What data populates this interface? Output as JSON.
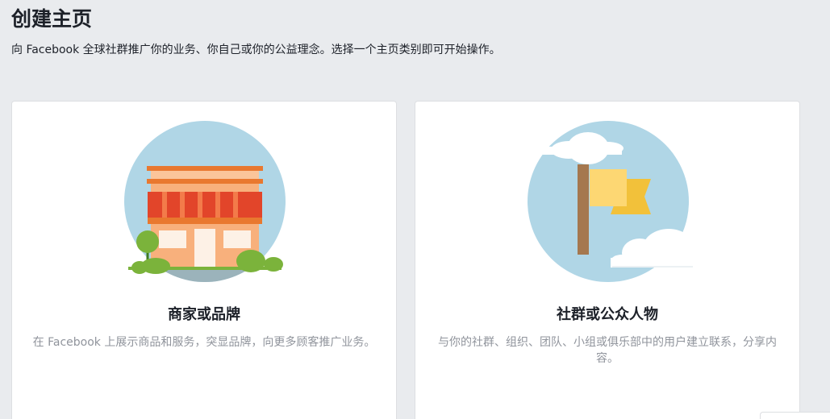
{
  "header": {
    "title": "创建主页",
    "subtitle": "向 Facebook 全球社群推广你的业务、你自己或你的公益理念。选择一个主页类别即可开始操作。"
  },
  "cards": [
    {
      "heading": "商家或品牌",
      "description": "在 Facebook 上展示商品和服务，突显品牌，向更多顾客推广业务。",
      "icon": "storefront-icon"
    },
    {
      "heading": "社群或公众人物",
      "description": "与你的社群、组织、团队、小组或俱乐部中的用户建立联系，分享内容。",
      "icon": "flag-icon"
    }
  ],
  "colors": {
    "background": "#e9ebee",
    "card": "#ffffff",
    "illustration_sky": "#b0d6e6",
    "awning_red": "#e2452a",
    "flag_yellow": "#fdd773",
    "grass_green": "#7bb33b",
    "description_gray": "#90949c"
  }
}
